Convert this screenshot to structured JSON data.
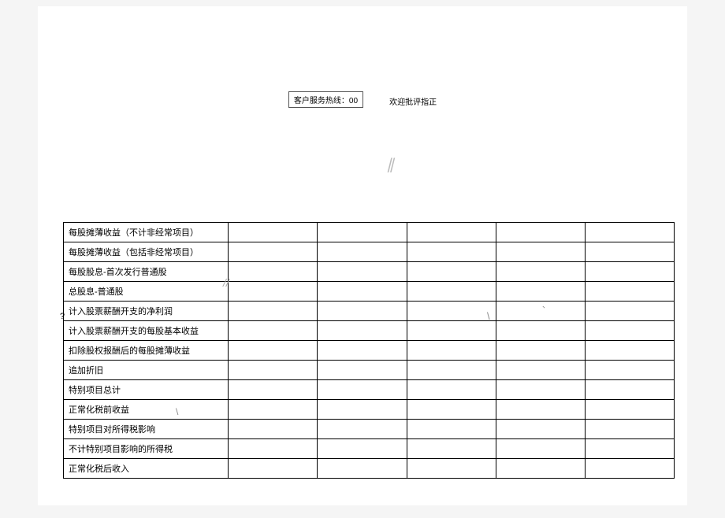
{
  "header": {
    "hotline": "客户服务热线：00",
    "feedback": "欢迎批评指正"
  },
  "marks": {
    "decor": "∥",
    "question": "?",
    "slash1": "//",
    "backslash1": "\\",
    "backslash2": "\\",
    "tick": "、"
  },
  "table": {
    "rows": [
      {
        "label": "每股摊薄收益（不计非经常项目）",
        "c1": "",
        "c2": "",
        "c3": "",
        "c4": "",
        "c5": ""
      },
      {
        "label": "每股摊薄收益（包括非经常项目）",
        "c1": "",
        "c2": "",
        "c3": "",
        "c4": "",
        "c5": ""
      },
      {
        "label": "每股股息-首次发行普通股",
        "c1": "",
        "c2": "",
        "c3": "",
        "c4": "",
        "c5": ""
      },
      {
        "label": "总股息-普通股",
        "c1": "",
        "c2": "",
        "c3": "",
        "c4": "",
        "c5": ""
      },
      {
        "label": "计入股票薪酬开支的净利润",
        "c1": "",
        "c2": "",
        "c3": "",
        "c4": "",
        "c5": ""
      },
      {
        "label": "计入股票薪酬开支的每股基本收益",
        "c1": "",
        "c2": "",
        "c3": "",
        "c4": "",
        "c5": ""
      },
      {
        "label": "扣除股权报酬后的每股摊薄收益",
        "c1": "",
        "c2": "",
        "c3": "",
        "c4": "",
        "c5": ""
      },
      {
        "label": "追加折旧",
        "c1": "",
        "c2": "",
        "c3": "",
        "c4": "",
        "c5": ""
      },
      {
        "label": "特别项目总计",
        "c1": "",
        "c2": "",
        "c3": "",
        "c4": "",
        "c5": ""
      },
      {
        "label": "正常化税前收益",
        "c1": "",
        "c2": "",
        "c3": "",
        "c4": "",
        "c5": ""
      },
      {
        "label": "特别项目对所得税影响",
        "c1": "",
        "c2": "",
        "c3": "",
        "c4": "",
        "c5": ""
      },
      {
        "label": "不计特别项目影响的所得税",
        "c1": "",
        "c2": "",
        "c3": "",
        "c4": "",
        "c5": ""
      },
      {
        "label": "正常化税后收入",
        "c1": "",
        "c2": "",
        "c3": "",
        "c4": "",
        "c5": ""
      }
    ]
  }
}
